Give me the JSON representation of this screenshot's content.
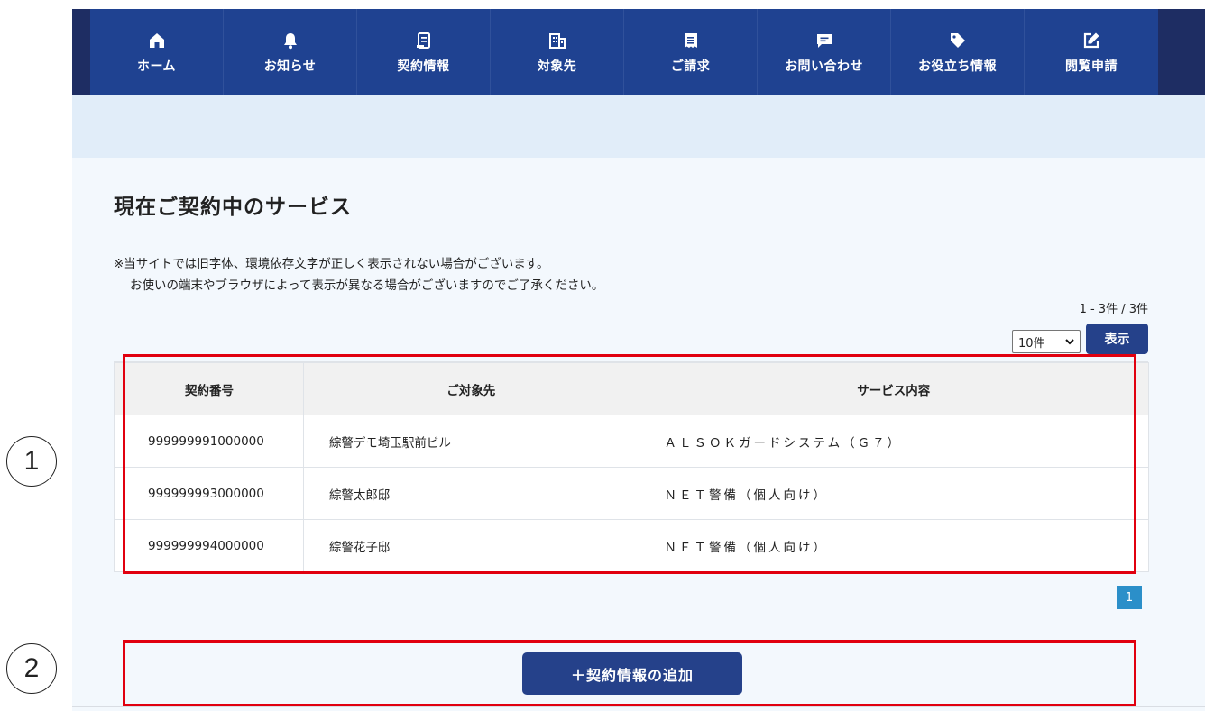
{
  "nav": {
    "items": [
      {
        "label": "ホーム",
        "icon": "home-icon"
      },
      {
        "label": "お知らせ",
        "icon": "bell-icon"
      },
      {
        "label": "契約情報",
        "icon": "document-icon"
      },
      {
        "label": "対象先",
        "icon": "building-icon"
      },
      {
        "label": "ご請求",
        "icon": "receipt-icon"
      },
      {
        "label": "お問い合わせ",
        "icon": "chat-icon"
      },
      {
        "label": "お役立ち情報",
        "icon": "tag-icon"
      },
      {
        "label": "閲覧申請",
        "icon": "edit-icon"
      }
    ]
  },
  "page": {
    "title": "現在ご契約中のサービス",
    "note_line1": "※当サイトでは旧字体、環境依存文字が正しく表示されない場合がございます。",
    "note_line2": "お使いの端末やブラウザによって表示が異なる場合がございますのでご了承ください。",
    "count": "1 - 3件 / 3件",
    "per_page": "10件",
    "show_button": "表示",
    "pagination_current": "1",
    "add_button": "＋契約情報の追加"
  },
  "table": {
    "headers": [
      "契約番号",
      "ご対象先",
      "サービス内容"
    ],
    "rows": [
      [
        "999999991000000",
        "綜警デモ埼玉駅前ビル",
        "ＡＬＳＯＫガードシステム（Ｇ７）"
      ],
      [
        "999999993000000",
        "綜警太郎邸",
        "ＮＥＴ警備（個人向け）"
      ],
      [
        "999999994000000",
        "綜警花子邸",
        "ＮＥＴ警備（個人向け）"
      ]
    ]
  },
  "annotations": {
    "marker1": "1",
    "marker2": "2"
  },
  "colors": {
    "nav_bg": "#1f4291",
    "accent_button": "#25418a",
    "annotation_red": "#e1000f",
    "pagination_blue": "#2b8fc9"
  }
}
